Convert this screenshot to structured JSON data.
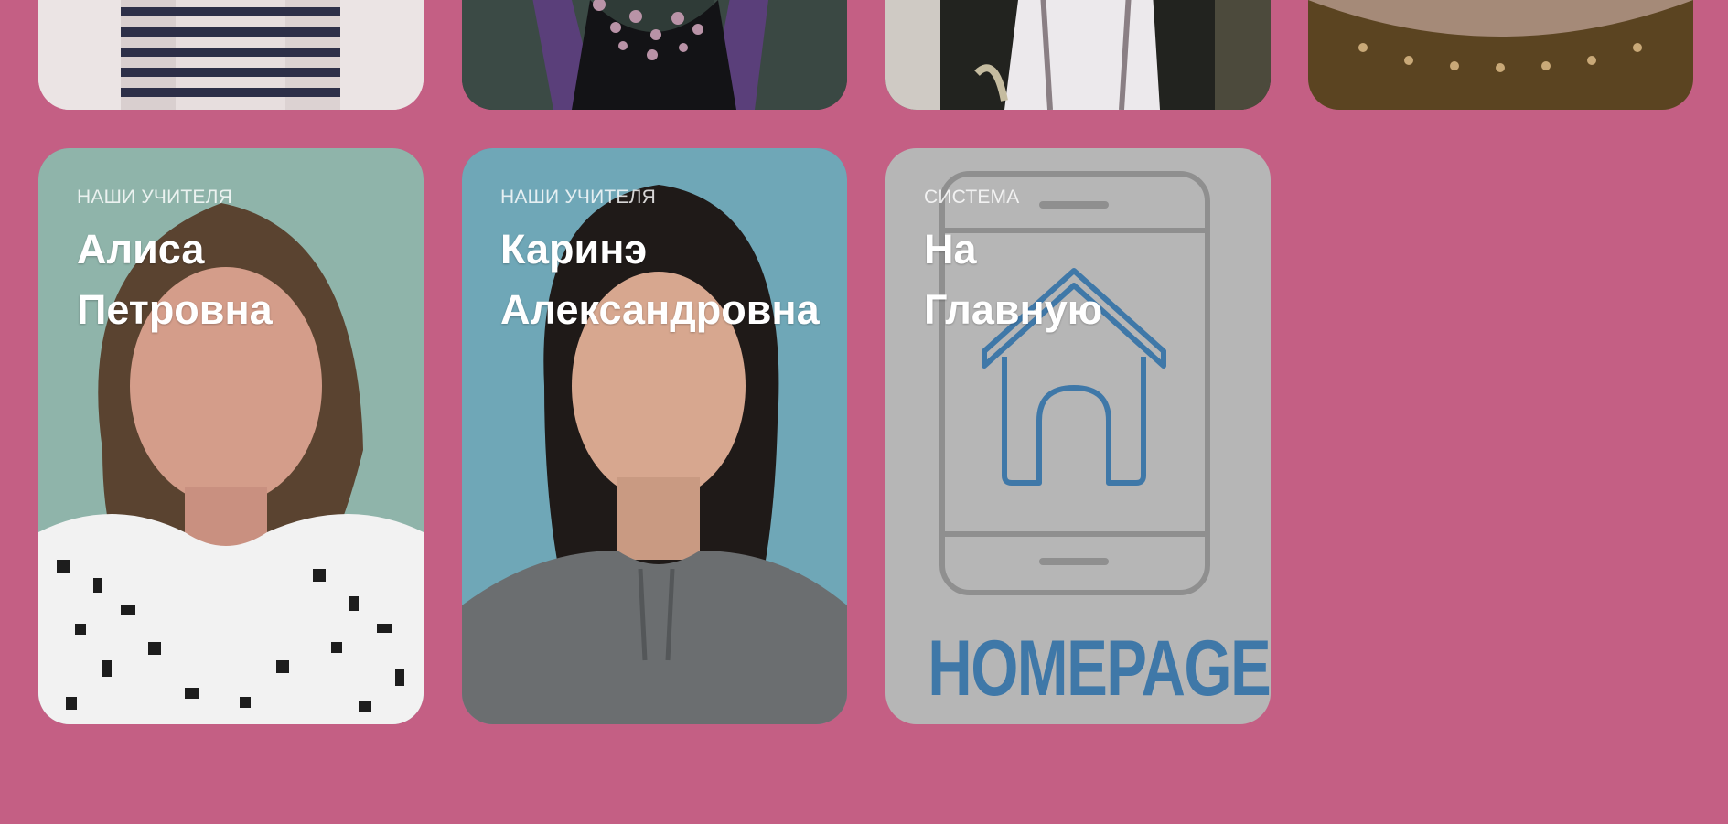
{
  "top_row": [
    {
      "id": "top-card-1"
    },
    {
      "id": "top-card-2"
    },
    {
      "id": "top-card-3"
    },
    {
      "id": "top-card-4"
    }
  ],
  "cards": [
    {
      "tag": "НАШИ УЧИТЕЛЯ",
      "name_line1": "Алиса",
      "name_line2": "Петровна"
    },
    {
      "tag": "НАШИ УЧИТЕЛЯ",
      "name_line1": "Каринэ",
      "name_line2": "Александровна"
    },
    {
      "tag": "СИСТЕМА",
      "name_line1": "На",
      "name_line2": "Главную",
      "logo_text": "HOMEPAGE"
    }
  ],
  "colors": {
    "background": "#c45f84",
    "homepage_blue": "#3f78a8",
    "homepage_card": "#c0c0c0"
  }
}
